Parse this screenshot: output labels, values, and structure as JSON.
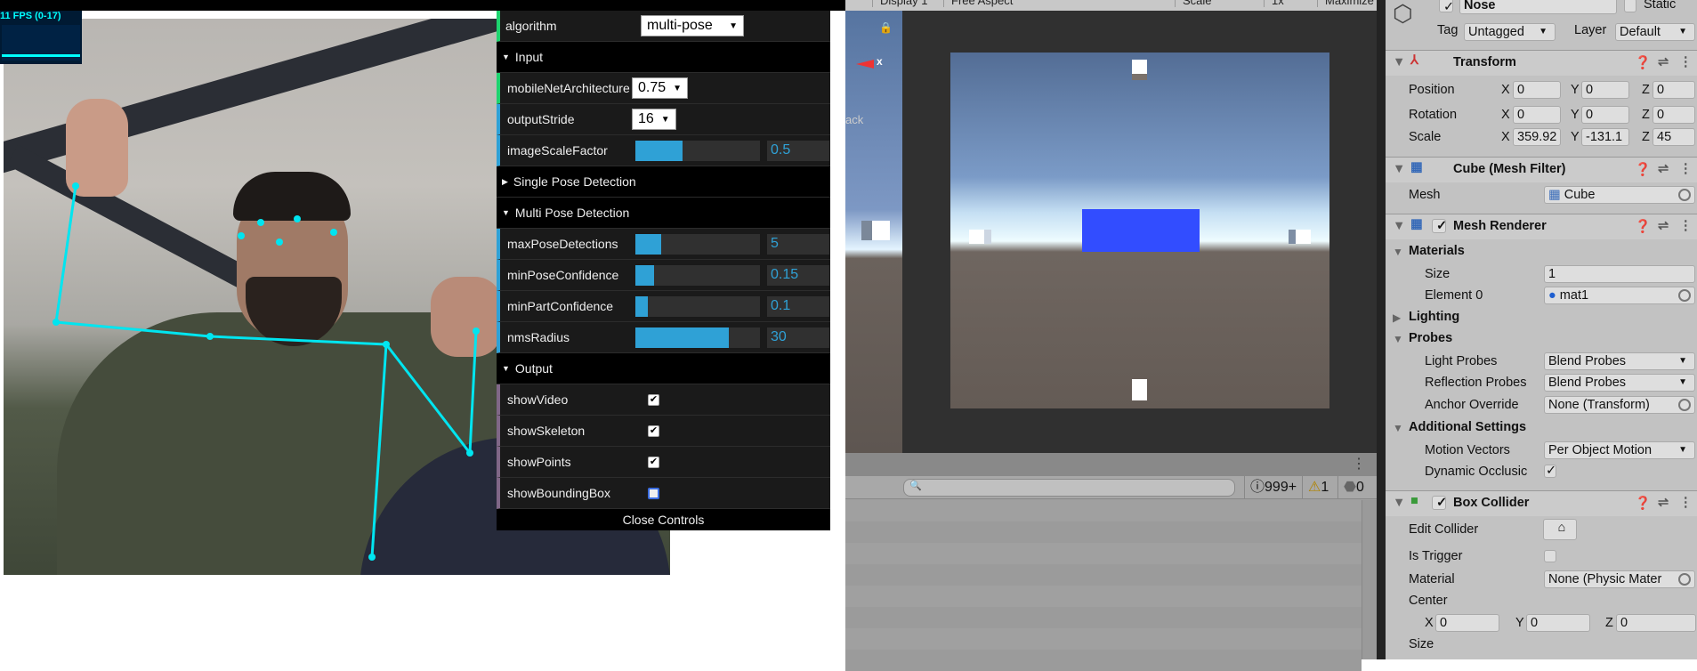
{
  "stats": {
    "fps_label": "11 FPS (0-17)"
  },
  "gui": {
    "algorithm": {
      "label": "algorithm",
      "value": "multi-pose"
    },
    "input": {
      "title": "Input",
      "mobileNetArchitecture": {
        "label": "mobileNetArchitecture",
        "value": "0.75"
      },
      "outputStride": {
        "label": "outputStride",
        "value": "16"
      },
      "imageScaleFactor": {
        "label": "imageScaleFactor",
        "value": "0.5",
        "fraction": 0.5,
        "min": 0.2,
        "max": 1.0
      }
    },
    "single": {
      "title": "Single Pose Detection"
    },
    "multi": {
      "title": "Multi Pose Detection",
      "maxPoseDetections": {
        "label": "maxPoseDetections",
        "value": "5",
        "fraction": 0.2
      },
      "minPoseConfidence": {
        "label": "minPoseConfidence",
        "value": "0.15",
        "fraction": 0.15
      },
      "minPartConfidence": {
        "label": "minPartConfidence",
        "value": "0.1",
        "fraction": 0.1
      },
      "nmsRadius": {
        "label": "nmsRadius",
        "value": "30",
        "fraction": 0.75
      }
    },
    "output": {
      "title": "Output",
      "showVideo": {
        "label": "showVideo",
        "checked": true
      },
      "showSkeleton": {
        "label": "showSkeleton",
        "checked": true
      },
      "showPoints": {
        "label": "showPoints",
        "checked": true
      },
      "showBoundingBox": {
        "label": "showBoundingBox",
        "checked": false
      }
    },
    "close": "Close Controls"
  },
  "pose": {
    "color": "#00e5f0"
  },
  "unity": {
    "toolbar": [
      "Display 1",
      "Free Aspect",
      "Scale",
      "1x",
      "Maximize"
    ],
    "scene": {
      "axis_label": "x",
      "persp_label": "ack"
    },
    "console": {
      "search_placeholder": "",
      "logs": "999+",
      "warnings": "1",
      "errors": "0"
    },
    "inspector": {
      "name": "Nose",
      "static": "Static",
      "tag_label": "Tag",
      "tag": "Untagged",
      "layer_label": "Layer",
      "layer": "Default",
      "transform": {
        "title": "Transform",
        "position": {
          "label": "Position",
          "x": "0",
          "y": "0",
          "z": "0"
        },
        "rotation": {
          "label": "Rotation",
          "x": "0",
          "y": "0",
          "z": "0"
        },
        "scale": {
          "label": "Scale",
          "x": "359.92",
          "y": "-131.1",
          "z": "45"
        }
      },
      "mesh_filter": {
        "title": "Cube (Mesh Filter)",
        "mesh_label": "Mesh",
        "mesh": "Cube"
      },
      "mesh_renderer": {
        "title": "Mesh Renderer",
        "materials": "Materials",
        "size_label": "Size",
        "size": "1",
        "element0_label": "Element 0",
        "element0": "mat1",
        "lighting": "Lighting",
        "probes": "Probes",
        "light_probes_label": "Light Probes",
        "light_probes": "Blend Probes",
        "reflection_probes_label": "Reflection Probes",
        "reflection_probes": "Blend Probes",
        "anchor_label": "Anchor Override",
        "anchor": "None (Transform)",
        "additional": "Additional Settings",
        "motion_label": "Motion Vectors",
        "motion": "Per Object Motion",
        "dynamic_label": "Dynamic Occlusic"
      },
      "box_collider": {
        "title": "Box Collider",
        "edit_label": "Edit Collider",
        "trigger_label": "Is Trigger",
        "material_label": "Material",
        "material": "None (Physic Mater",
        "center_label": "Center",
        "center": {
          "x": "0",
          "y": "0",
          "z": "0"
        },
        "size_label": "Size"
      },
      "axis": {
        "x": "X",
        "y": "Y",
        "z": "Z"
      }
    }
  }
}
